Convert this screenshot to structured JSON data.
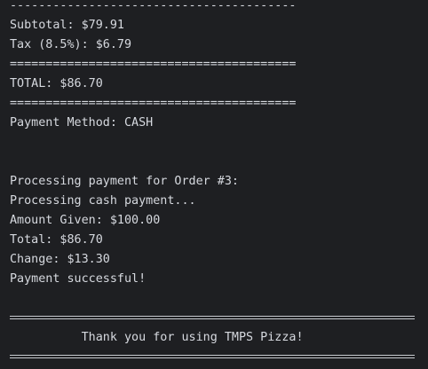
{
  "console": {
    "lines": {
      "dash_rule": "----------------------------------------",
      "subtotal": "Subtotal: $79.91",
      "tax": "Tax (8.5%): $6.79",
      "eq_rule_top": "========================================",
      "total": "TOTAL: $86.70",
      "eq_rule_bottom": "========================================",
      "payment_method": "Payment Method: CASH",
      "processing_order": "Processing payment for Order #3:",
      "processing_cash": "Processing cash payment...",
      "amount_given": "Amount Given: $100.00",
      "total_again": "Total: $86.70",
      "change": "Change: $13.30",
      "payment_success": "Payment successful!",
      "thank_you": "          Thank you for using TMPS Pizza!"
    }
  },
  "colors": {
    "background": "#1e1f22",
    "text": "#d6d9df",
    "rule": "#c9ccd1"
  }
}
